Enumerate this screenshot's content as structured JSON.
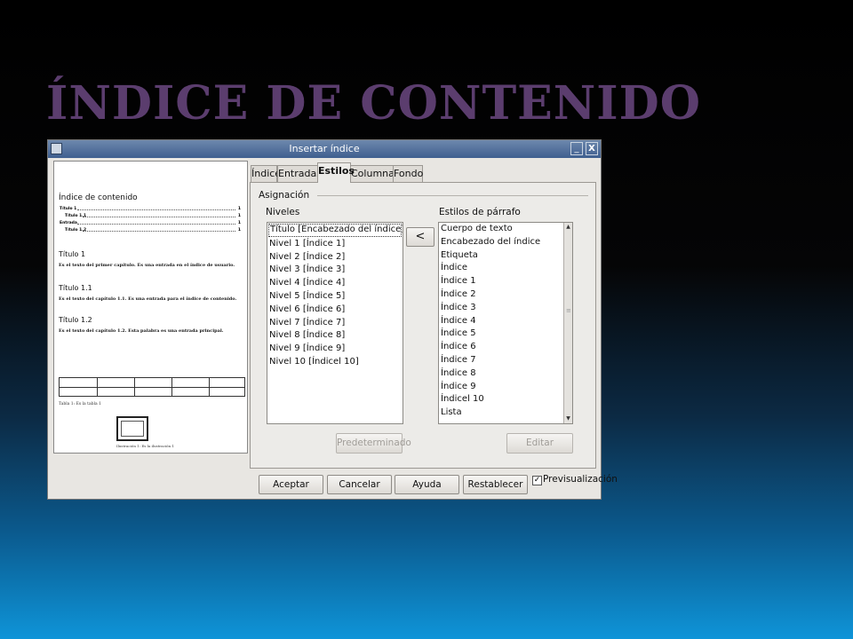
{
  "slide": {
    "title": "ÍNDICE DE CONTENIDO"
  },
  "window": {
    "title": "Insertar índice",
    "minimize_label": "_",
    "close_label": "X"
  },
  "preview": {
    "heading": "Índice de contenido",
    "toc": [
      {
        "text": "Título 1",
        "page": "1"
      },
      {
        "text": "Título 1.1",
        "page": "1"
      },
      {
        "text": "Entrada",
        "page": "1"
      },
      {
        "text": "Título 1.2",
        "page": "1"
      }
    ],
    "sections": [
      {
        "heading": "Título 1",
        "body": "Es el texto del primer capítulo. Es una entrada en el índice de usuario."
      },
      {
        "heading": "Título 1.1",
        "body": "Es el texto del capítulo 1.1. Es una entrada para el índice de contenido."
      },
      {
        "heading": "Título 1.2",
        "body": "Es el texto del capítulo 1.2. Esta palabra es una entrada principal."
      }
    ],
    "table_caption": "Tabla 1: Es la tabla 1",
    "image_caption": "Ilustración 1: Es la ilustración 1"
  },
  "tabs": [
    {
      "label": "Índice",
      "active": false
    },
    {
      "label": "Entradas",
      "active": false
    },
    {
      "label": "Estilos",
      "active": true
    },
    {
      "label": "Columnas",
      "active": false
    },
    {
      "label": "Fondo",
      "active": false
    }
  ],
  "assignment": {
    "group_label": "Asignación",
    "levels_label": "Niveles",
    "styles_label": "Estilos de párrafo",
    "assign_button": "<",
    "levels": [
      "Título [Encabezado del índice]",
      "Nivel 1 [Índice 1]",
      "Nivel 2 [Índice 2]",
      "Nivel 3 [Índice 3]",
      "Nivel 4 [Índice 4]",
      "Nivel 5 [Índice 5]",
      "Nivel 6 [Índice 6]",
      "Nivel 7 [Índice 7]",
      "Nivel 8 [Índice 8]",
      "Nivel 9 [Índice 9]",
      "Nivel 10 [Índicel 10]"
    ],
    "selected_level": 0,
    "paragraph_styles": [
      "Cuerpo de texto",
      "Encabezado del índice",
      "Etiqueta",
      "Índice",
      "Índice 1",
      "Índice 2",
      "Índice 3",
      "Índice 4",
      "Índice 5",
      "Índice 6",
      "Índice 7",
      "Índice 8",
      "Índice 9",
      "Índicel 10",
      "Lista"
    ],
    "default_button": "Predeterminado",
    "edit_button": "Editar"
  },
  "footer": {
    "ok": "Aceptar",
    "cancel": "Cancelar",
    "help": "Ayuda",
    "reset": "Restablecer",
    "preview_label": "Previsualización",
    "preview_checked": true
  }
}
